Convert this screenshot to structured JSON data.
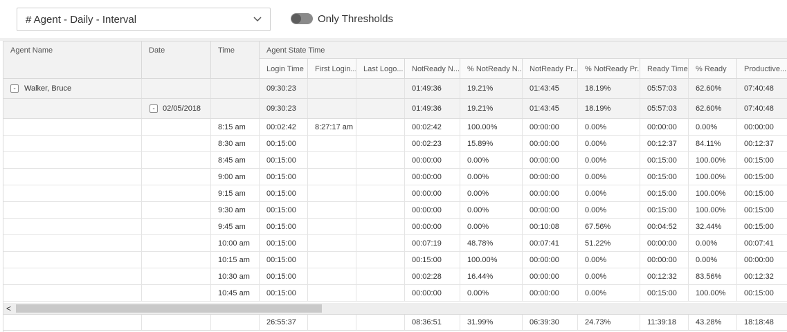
{
  "toolbar": {
    "report_select": {
      "value": "# Agent - Daily - Interval"
    },
    "only_thresholds": {
      "label": "Only Thresholds",
      "on": false
    }
  },
  "grid": {
    "headers": {
      "agent_name": "Agent Name",
      "date": "Date",
      "time": "Time",
      "group": "Agent State Time",
      "columns": [
        "Login Time",
        "First Login...",
        "Last Logo...",
        "NotReady N...",
        "% NotReady N...",
        "NotReady Pr...",
        "% NotReady Pr...",
        "Ready Time",
        "% Ready",
        "Productive..."
      ]
    },
    "agent_row": {
      "name": "Walker, Bruce",
      "expander": "-",
      "values": [
        "09:30:23",
        "",
        "",
        "01:49:36",
        "19.21%",
        "01:43:45",
        "18.19%",
        "05:57:03",
        "62.60%",
        "07:40:48"
      ]
    },
    "date_row": {
      "date": "02/05/2018",
      "expander": "-",
      "values": [
        "09:30:23",
        "",
        "",
        "01:49:36",
        "19.21%",
        "01:43:45",
        "18.19%",
        "05:57:03",
        "62.60%",
        "07:40:48"
      ]
    },
    "rows": [
      {
        "time": "8:15 am",
        "values": [
          "00:02:42",
          "8:27:17 am",
          "",
          "00:02:42",
          "100.00%",
          "00:00:00",
          "0.00%",
          "00:00:00",
          "0.00%",
          "00:00:00"
        ]
      },
      {
        "time": "8:30 am",
        "values": [
          "00:15:00",
          "",
          "",
          "00:02:23",
          "15.89%",
          "00:00:00",
          "0.00%",
          "00:12:37",
          "84.11%",
          "00:12:37"
        ]
      },
      {
        "time": "8:45 am",
        "values": [
          "00:15:00",
          "",
          "",
          "00:00:00",
          "0.00%",
          "00:00:00",
          "0.00%",
          "00:15:00",
          "100.00%",
          "00:15:00"
        ]
      },
      {
        "time": "9:00 am",
        "values": [
          "00:15:00",
          "",
          "",
          "00:00:00",
          "0.00%",
          "00:00:00",
          "0.00%",
          "00:15:00",
          "100.00%",
          "00:15:00"
        ]
      },
      {
        "time": "9:15 am",
        "values": [
          "00:15:00",
          "",
          "",
          "00:00:00",
          "0.00%",
          "00:00:00",
          "0.00%",
          "00:15:00",
          "100.00%",
          "00:15:00"
        ]
      },
      {
        "time": "9:30 am",
        "values": [
          "00:15:00",
          "",
          "",
          "00:00:00",
          "0.00%",
          "00:00:00",
          "0.00%",
          "00:15:00",
          "100.00%",
          "00:15:00"
        ]
      },
      {
        "time": "9:45 am",
        "values": [
          "00:15:00",
          "",
          "",
          "00:00:00",
          "0.00%",
          "00:10:08",
          "67.56%",
          "00:04:52",
          "32.44%",
          "00:15:00"
        ]
      },
      {
        "time": "10:00 am",
        "values": [
          "00:15:00",
          "",
          "",
          "00:07:19",
          "48.78%",
          "00:07:41",
          "51.22%",
          "00:00:00",
          "0.00%",
          "00:07:41"
        ]
      },
      {
        "time": "10:15 am",
        "values": [
          "00:15:00",
          "",
          "",
          "00:15:00",
          "100.00%",
          "00:00:00",
          "0.00%",
          "00:00:00",
          "0.00%",
          "00:00:00"
        ]
      },
      {
        "time": "10:30 am",
        "values": [
          "00:15:00",
          "",
          "",
          "00:02:28",
          "16.44%",
          "00:00:00",
          "0.00%",
          "00:12:32",
          "83.56%",
          "00:12:32"
        ]
      },
      {
        "time": "10:45 am",
        "values": [
          "00:15:00",
          "",
          "",
          "00:00:00",
          "0.00%",
          "00:00:00",
          "0.00%",
          "00:15:00",
          "100.00%",
          "00:15:00"
        ]
      }
    ],
    "scrollbar": {
      "left_arrow": "<"
    },
    "totals": [
      "26:55:37",
      "",
      "",
      "08:36:51",
      "31.99%",
      "06:39:30",
      "24.73%",
      "11:39:18",
      "43.28%",
      "18:18:48"
    ]
  }
}
